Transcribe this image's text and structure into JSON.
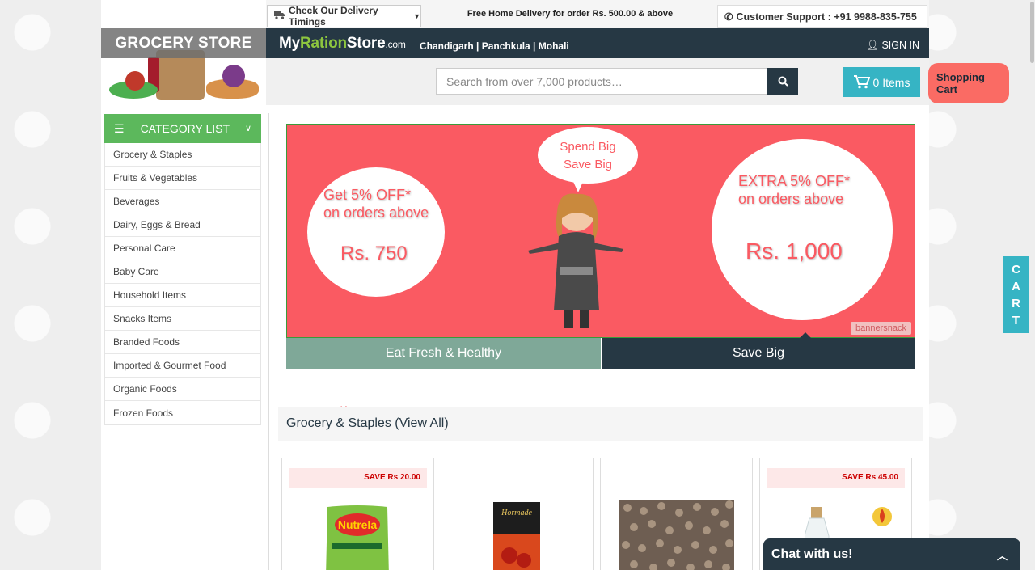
{
  "header": {
    "delivery_timings": "Check Our Delivery Timings",
    "free_delivery_note": "Free Home Delivery for order Rs. 500.00 & above",
    "support": "Customer Support : +91 9988-835-755",
    "logo_text": "GROCERY STORE",
    "brand_my": "My",
    "brand_ration": "Ration",
    "brand_store": "Store",
    "brand_com": ".com",
    "cities": "Chandigarh | Panchkula | Mohali",
    "sign_in": "SIGN IN",
    "search_placeholder": "Search from over 7,000 products…",
    "cart_items": "0 Items",
    "shopping_cart": "Shopping Cart"
  },
  "sidebar": {
    "title": "CATEGORY LIST",
    "items": [
      {
        "label": "Grocery & Staples"
      },
      {
        "label": "Fruits & Vegetables"
      },
      {
        "label": "Beverages"
      },
      {
        "label": "Dairy, Eggs & Bread"
      },
      {
        "label": "Personal Care"
      },
      {
        "label": "Baby Care"
      },
      {
        "label": "Household Items"
      },
      {
        "label": "Snacks Items"
      },
      {
        "label": "Branded Foods"
      },
      {
        "label": "Imported & Gourmet Food"
      },
      {
        "label": "Organic Foods"
      },
      {
        "label": "Frozen Foods"
      }
    ]
  },
  "banner": {
    "bubble_line1": "Spend Big",
    "bubble_line2": "Save Big",
    "offer1_line1": "Get 5% OFF*",
    "offer1_line2": "on orders above",
    "offer1_amount": "Rs. 750",
    "offer2_line1": "EXTRA 5% OFF*",
    "offer2_line2": "on orders above",
    "offer2_amount": "Rs. 1,000",
    "badge": "bannersnack",
    "tab1": "Eat Fresh & Healthy",
    "tab2": "Save Big"
  },
  "section": {
    "title": "Grocery & Staples (View All)"
  },
  "products": [
    {
      "save": "SAVE Rs 20.00",
      "brand": "Nutrela"
    },
    {
      "save": "",
      "brand": "Hormade"
    },
    {
      "save": "",
      "brand": ""
    },
    {
      "save": "SAVE Rs 45.00",
      "brand": ""
    }
  ],
  "cart_tab": [
    "C",
    "A",
    "R",
    "T"
  ],
  "chat": {
    "label": "Chat with us!"
  },
  "colors": {
    "nav": "#263844",
    "green": "#5cb85c",
    "teal": "#36b4c4",
    "banner": "#fa5a62"
  }
}
